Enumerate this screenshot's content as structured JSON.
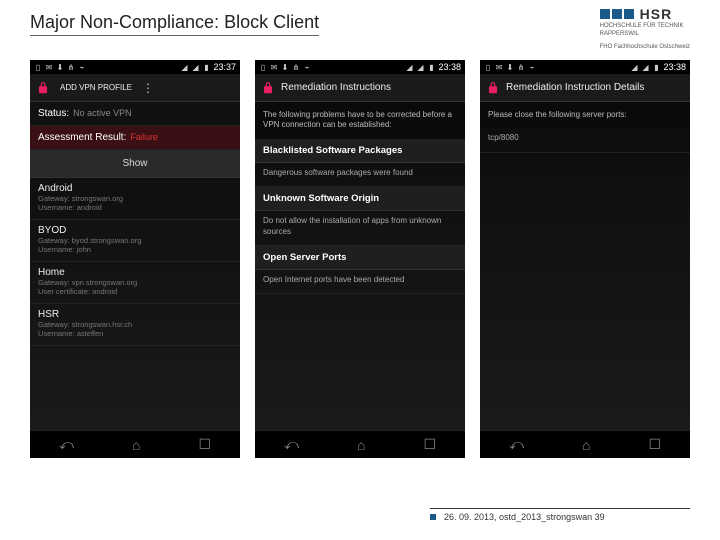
{
  "slide": {
    "title": "Major Non-Compliance:  Block Client",
    "footer": "26. 09. 2013, ostd_2013_strongswan 39"
  },
  "logo": {
    "name": "HSR",
    "sub1": "HOCHSCHULE FÜR TECHNIK",
    "sub2": "RAPPERSWIL",
    "fho": "FHO Fachhochschule Ostschweiz"
  },
  "phones": [
    {
      "time": "23:37",
      "add_label": "ADD VPN PROFILE",
      "status_label": "Status:",
      "status_value": "No active VPN",
      "assess_label": "Assessment Result:",
      "assess_value": "Failure",
      "show": "Show",
      "connections": [
        {
          "name": "Android",
          "l1": "Gateway: strongswan.org",
          "l2": "Username: android"
        },
        {
          "name": "BYOD",
          "l1": "Gateway: byod.strongswan.org",
          "l2": "Username: john"
        },
        {
          "name": "Home",
          "l1": "Gateway: vpn.strongswan.org",
          "l2": "User certificate: android"
        },
        {
          "name": "HSR",
          "l1": "Gateway: strongswan.hsr.ch",
          "l2": "Username: asteffen"
        }
      ]
    },
    {
      "time": "23:38",
      "title": "Remediation Instructions",
      "intro": "The following problems have to be corrected before a VPN connection can be established:",
      "sections": [
        {
          "hdr": "Blacklisted Software Packages",
          "body": "Dangerous software packages were found"
        },
        {
          "hdr": "Unknown Software Origin",
          "body": "Do not allow the installation of apps from unknown sources"
        },
        {
          "hdr": "Open Server Ports",
          "body": "Open Internet ports have been detected"
        }
      ]
    },
    {
      "time": "23:38",
      "title": "Remediation Instruction Details",
      "intro": "Please close the following server ports:",
      "detail": "tcp/8080"
    }
  ]
}
